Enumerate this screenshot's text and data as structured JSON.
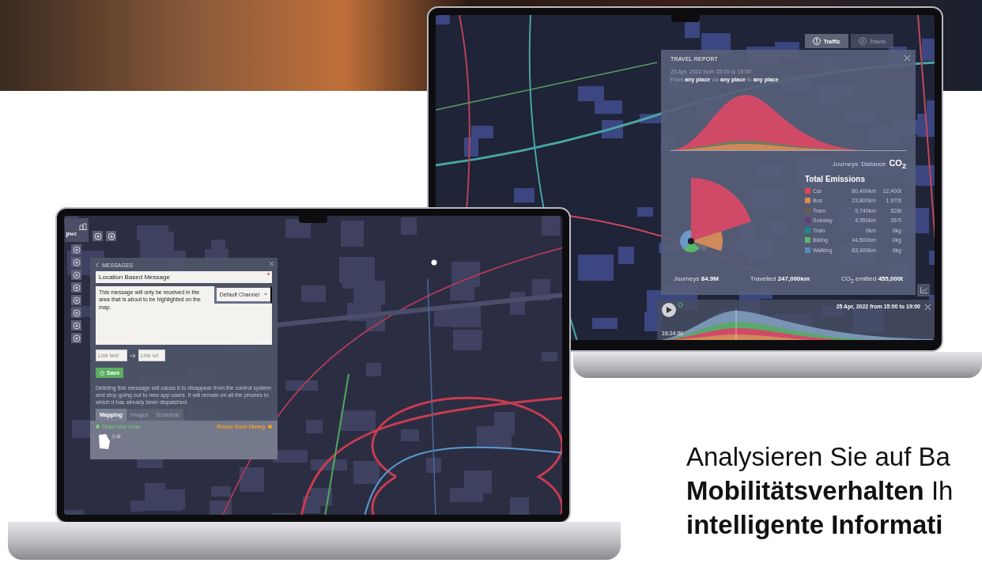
{
  "report_laptop": {
    "tabs": [
      {
        "label": "Traffic",
        "selected": true
      },
      {
        "label": "Travel",
        "selected": false
      }
    ],
    "report": {
      "title": "TRAVEL REPORT",
      "date": "25 Apr, 2022 from 15:00 to 19:00",
      "route": "From **any place** via **any place** to **any place**",
      "metrics": [
        {
          "label": "Journeys",
          "selected": false
        },
        {
          "label": "Distance",
          "selected": false
        },
        {
          "label": "CO$_{2}$",
          "selected": true
        }
      ],
      "emissions_title": "Total Emissions",
      "emissions": [
        {
          "mode": "Car",
          "color": "#e8415a",
          "distance": "80,400km",
          "co2": "12,400t"
        },
        {
          "mode": "Bus",
          "color": "#e08a52",
          "distance": "23,800km",
          "co2": "1,970t"
        },
        {
          "mode": "Tram",
          "color": "#6b5c4c",
          "distance": "9,740km",
          "co2": "526t"
        },
        {
          "mode": "Subway",
          "color": "#6a3a7a",
          "distance": "4,950km",
          "co2": "267t"
        },
        {
          "mode": "Train",
          "color": "#1a8a8a",
          "distance": "0km",
          "co2": "0kg"
        },
        {
          "mode": "Biking",
          "color": "#5ab86a",
          "distance": "44,500km",
          "co2": "0kg"
        },
        {
          "mode": "Walking",
          "color": "#5a8ac0",
          "distance": "83,400km",
          "co2": "0kg"
        }
      ],
      "summary": [
        "Journeys **84.9M**",
        "Travelled **247,000km**",
        "CO$_{2}$ emitted **455,000t**"
      ]
    },
    "timeline": {
      "time": "16:24:00",
      "range": "25 Apr, 2022 from 15:00 to 19:00"
    }
  },
  "messages_laptop": {
    "logo": "pwc",
    "messages": {
      "header": "MESSAGES",
      "title_value": "Location Based Message",
      "body_value": "This message will only be received in the area that is about to be highlighted on the map.",
      "channel": "Default Channel",
      "link_text_placeholder": "Link text",
      "link_url_placeholder": "Link url",
      "save": "Save",
      "note": "Deleting this message will cause it to disappear from the control system and stop going out to new app users. It will remain on all the phones to which it has already been dispatched.",
      "tabs": [
        {
          "label": "Mapping",
          "selected": true
        },
        {
          "label": "Images",
          "selected": false
        },
        {
          "label": "Schedule",
          "selected": false
        }
      ],
      "draw_zone": "Draw new zone",
      "reuse": "Reuse from library"
    }
  },
  "headline": [
    "Analysieren Sie auf Ba",
    "**Mobilitätsverhalten** Ih",
    "**intelligente Informati**"
  ]
}
